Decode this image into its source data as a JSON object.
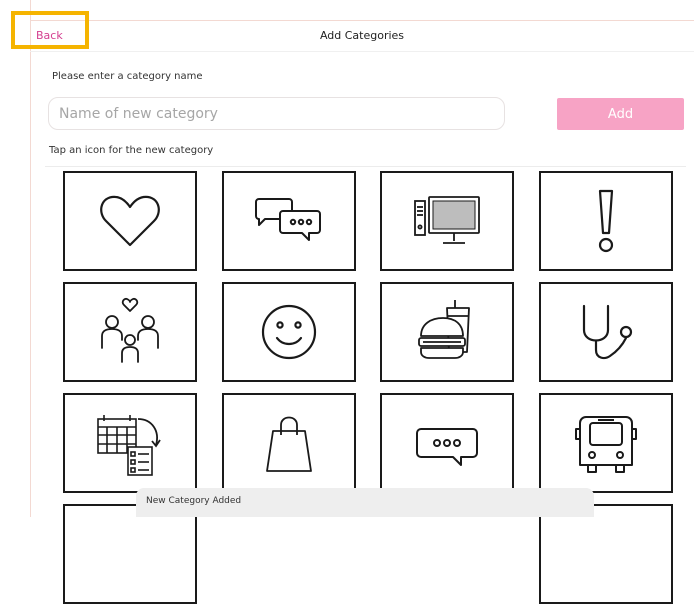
{
  "header": {
    "back_label": "Back",
    "title": "Add Categories"
  },
  "form": {
    "name_label": "Please enter a category name",
    "name_placeholder": "Name of new category",
    "name_value": "",
    "add_label": "Add",
    "icons_label": "Tap an icon for the new category"
  },
  "icons": [
    "heart-icon",
    "chat-bubbles-icon",
    "computer-icon",
    "exclamation-icon",
    "family-icon",
    "smiley-face-icon",
    "fast-food-icon",
    "stethoscope-icon",
    "calendar-schedule-icon",
    "shopping-bag-icon",
    "speech-bubble-icon",
    "bus-icon"
  ],
  "toast": {
    "message": "New Category Added"
  },
  "colors": {
    "accent": "#d43e8f",
    "add_button": "#f7a3c5",
    "highlight": "#f5b400"
  }
}
